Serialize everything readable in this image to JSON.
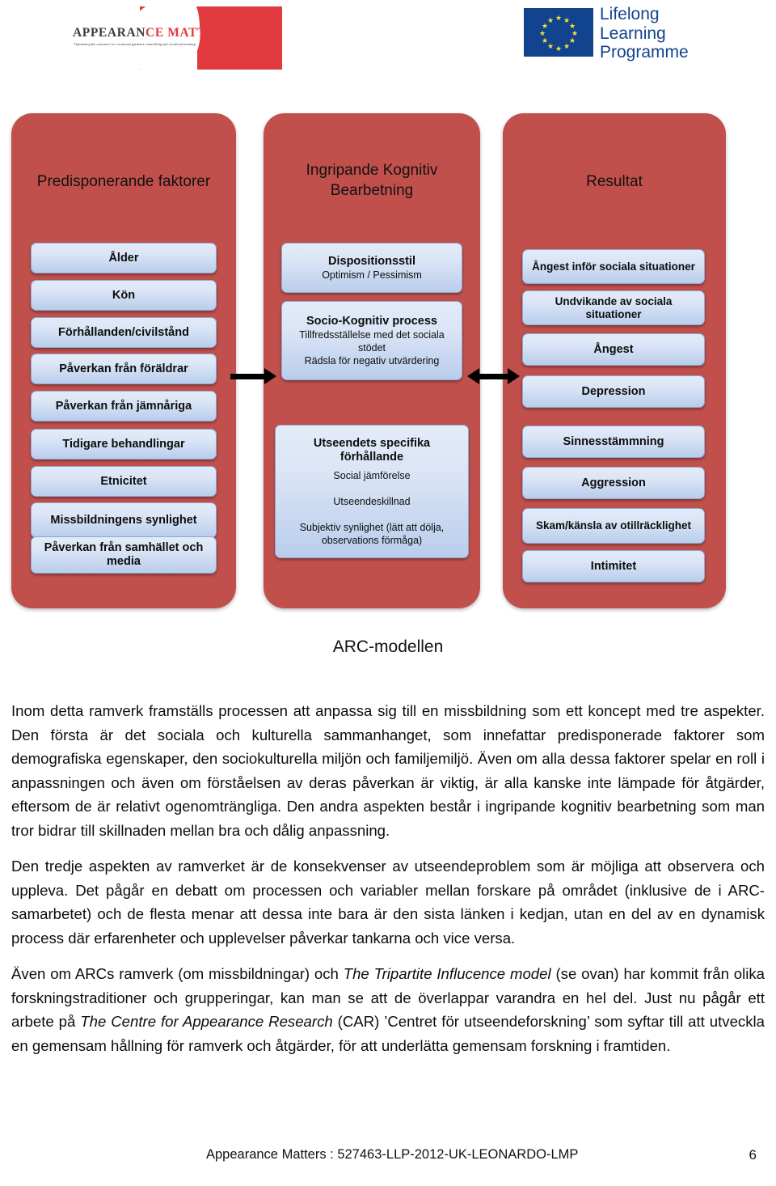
{
  "header": {
    "appearance_matters_logo": {
      "title_part1": "APPEARAN",
      "title_part2": "CE MATTERS",
      "tagline": "'Optimizing the outcomes for vocational guidance counselling and vocational training'"
    },
    "eu_logo": {
      "line1": "Lifelong",
      "line2": "Learning",
      "line3": "Programme"
    }
  },
  "diagram": {
    "caption": "ARC-modellen",
    "panels": [
      {
        "title": "Predisponerande faktorer",
        "boxes": [
          {
            "title": "Ålder",
            "sub": ""
          },
          {
            "title": "Kön",
            "sub": ""
          },
          {
            "title": "Förhållanden/civilstånd",
            "sub": ""
          },
          {
            "title": "Påverkan från föräldrar",
            "sub": ""
          },
          {
            "title": "Påverkan från jämnåriga",
            "sub": ""
          },
          {
            "title": "Tidigare behandlingar",
            "sub": ""
          },
          {
            "title": "Etnicitet",
            "sub": ""
          },
          {
            "title": "Missbildningens synlighet",
            "sub": ""
          },
          {
            "title": "Påverkan från samhället och media",
            "sub": ""
          }
        ]
      },
      {
        "title": "Ingripande Kognitiv Bearbetning",
        "boxes": [
          {
            "title": "Dispositionsstil",
            "sub": "Optimism / Pessimism"
          },
          {
            "title": "Socio-Kognitiv process",
            "sub": "Tillfredsställelse med det sociala stödet\nRädsla för negativ utvärdering"
          },
          {
            "title": "Utseendets specifika förhållande",
            "sub": "Social jämförelse\n\nUtseendeskillnad\n\nSubjektiv synlighet (lätt att dölja, observations förmåga)"
          }
        ]
      },
      {
        "title": "Resultat",
        "boxes": [
          {
            "title": "Ångest inför sociala situationer",
            "sub": ""
          },
          {
            "title": "Undvikande av sociala situationer",
            "sub": ""
          },
          {
            "title": "Ångest",
            "sub": ""
          },
          {
            "title": "Depression",
            "sub": ""
          },
          {
            "title": "Sinnesstämmning",
            "sub": ""
          },
          {
            "title": "Aggression",
            "sub": ""
          },
          {
            "title": "Skam/känsla av otillräcklighet",
            "sub": ""
          },
          {
            "title": "Intimitet",
            "sub": ""
          }
        ]
      }
    ],
    "arrows": [
      {
        "name": "arrow-predisposing-to-cognitive",
        "direction": "right"
      },
      {
        "name": "arrow-cognitive-to-outcome",
        "direction": "both"
      }
    ]
  },
  "body": {
    "paragraphs": [
      "Inom detta ramverk framställs processen att anpassa sig till en missbildning som ett koncept med tre aspekter. Den första är det sociala och kulturella sammanhanget, som innefattar predisponerade faktorer som demografiska egenskaper, den sociokulturella miljön och familjemiljö. Även om alla dessa faktorer spelar en roll i anpassningen och även om förståelsen av deras påverkan är viktig, är alla kanske inte lämpade för åtgärder, eftersom de är relativt ogenomträngliga. Den andra aspekten består i ingripande kognitiv bearbetning som man tror bidrar till skillnaden mellan bra och dålig anpassning.",
      "Den tredje aspekten av ramverket är de konsekvenser av utseendeproblem som är möjliga att observera och uppleva. Det pågår en debatt om processen och variabler mellan forskare på området (inklusive de i ARC-samarbetet) och de flesta menar att dessa inte bara är den sista länken i kedjan, utan en del av en dynamisk process där erfarenheter och upplevelser påverkar tankarna och vice versa."
    ],
    "paragraph3_parts": {
      "t1": "Även om ARCs ramverk (om missbildningar) och ",
      "i1": "The Tripartite Influcence model",
      "t2": " (se ovan) har kommit från olika forskningstraditioner och grupperingar, kan man se att de överlappar varandra en hel del. Just nu pågår ett arbete på ",
      "i2": "The Centre for Appearance Research",
      "t3": " (CAR) ’Centret för utseendeforskning’ som syftar till att utveckla en gemensam hållning för ramverk och åtgärder, för att underlätta gemensam forskning i framtiden."
    }
  },
  "footer": {
    "text": "Appearance Matters :  527463-LLP-2012-UK-LEONARDO-LMP",
    "page": "6"
  },
  "colors": {
    "panel_red": "#c1504d",
    "box_blue_light": "#e3ebf8",
    "box_blue_dark": "#b9cdec",
    "box_border": "#8ea9d0",
    "eu_blue": "#12438f",
    "am_red": "#e03a3e"
  }
}
